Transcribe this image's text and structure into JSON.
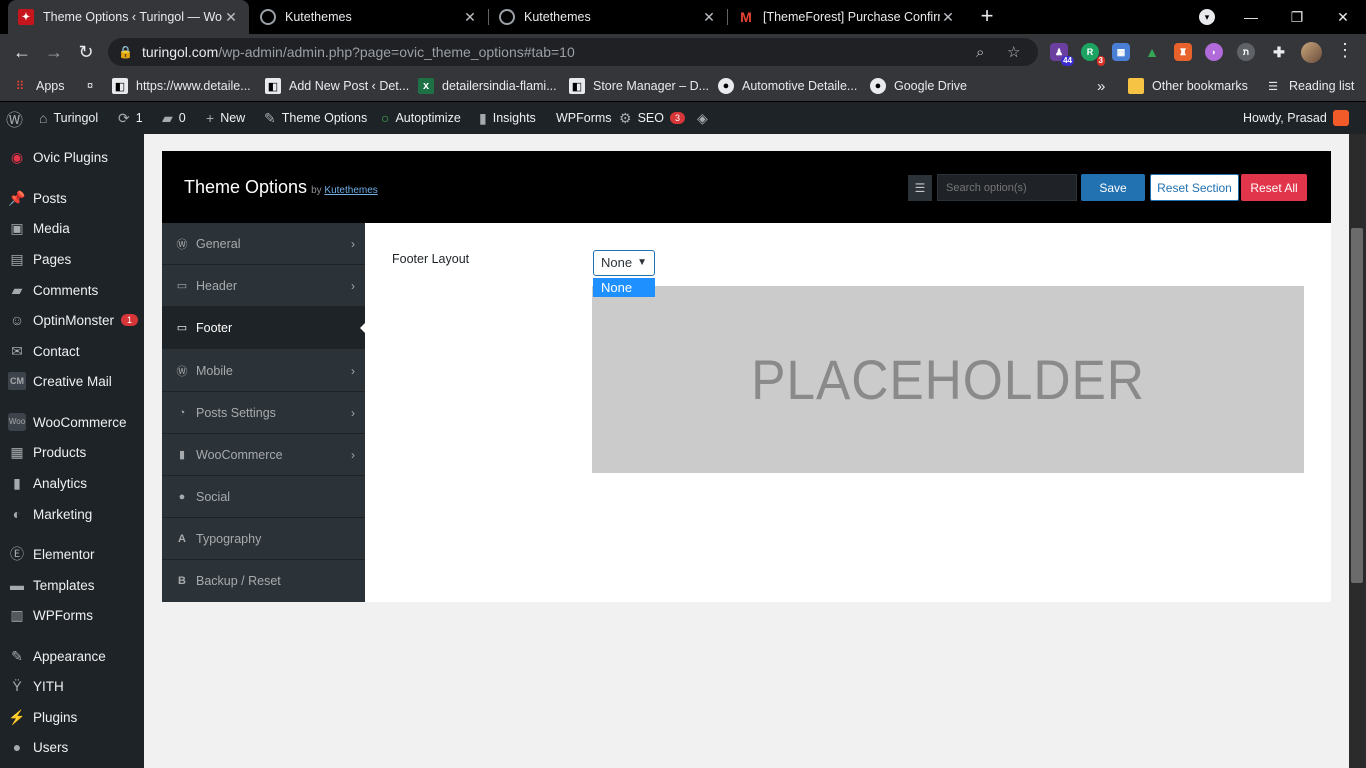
{
  "browser": {
    "tabs": [
      {
        "title": "Theme Options ‹ Turingol — Wo",
        "active": true
      },
      {
        "title": "Kutethemes",
        "active": false
      },
      {
        "title": "Kutethemes",
        "active": false
      },
      {
        "title": "[ThemeForest] Purchase Confirm",
        "active": false
      }
    ],
    "new_tab": "+",
    "url_host": "turingol.com",
    "url_path": "/wp-admin/admin.php?page=ovic_theme_options#tab=10",
    "extensions": [
      {
        "name": "ext-badge-44",
        "badge": "44"
      },
      {
        "name": "ext-badge-3",
        "badge": "3"
      }
    ],
    "bookmarks": [
      {
        "label": "Apps"
      },
      {
        "label": ""
      },
      {
        "label": "https://www.detaile..."
      },
      {
        "label": "Add New Post ‹ Det..."
      },
      {
        "label": "detailersindia-flami..."
      },
      {
        "label": "Store Manager – D..."
      },
      {
        "label": "Automotive Detaile..."
      },
      {
        "label": "Google Drive"
      }
    ],
    "bookmarks_overflow": "»",
    "other_bookmarks": "Other bookmarks",
    "reading_list": "Reading list"
  },
  "adminbar": {
    "site": "Turingol",
    "updates": "1",
    "comments": "0",
    "new": "New",
    "theme_options": "Theme Options",
    "autoptimize": "Autoptimize",
    "insights": "Insights",
    "wpforms": "WPForms",
    "seo": "SEO",
    "seo_badge": "3",
    "howdy": "Howdy, Prasad"
  },
  "sidebar": {
    "items": [
      {
        "label": "Ovic Plugins",
        "icon": "ovic-icon"
      },
      {
        "label": "Posts",
        "icon": "pin-icon"
      },
      {
        "label": "Media",
        "icon": "media-icon"
      },
      {
        "label": "Pages",
        "icon": "pages-icon"
      },
      {
        "label": "Comments",
        "icon": "comment-icon"
      },
      {
        "label": "OptinMonster",
        "icon": "optinmonster-icon",
        "badge": "1"
      },
      {
        "label": "Contact",
        "icon": "mail-icon"
      },
      {
        "label": "Creative Mail",
        "icon": "cm-icon"
      },
      {
        "label": "WooCommerce",
        "icon": "woo-icon"
      },
      {
        "label": "Products",
        "icon": "products-icon"
      },
      {
        "label": "Analytics",
        "icon": "analytics-icon"
      },
      {
        "label": "Marketing",
        "icon": "megaphone-icon"
      },
      {
        "label": "Elementor",
        "icon": "elementor-icon"
      },
      {
        "label": "Templates",
        "icon": "folder-icon"
      },
      {
        "label": "WPForms",
        "icon": "wpforms-icon"
      },
      {
        "label": "Appearance",
        "icon": "brush-icon"
      },
      {
        "label": "YITH",
        "icon": "yith-icon"
      },
      {
        "label": "Plugins",
        "icon": "plugin-icon"
      },
      {
        "label": "Users",
        "icon": "users-icon"
      }
    ]
  },
  "panel": {
    "title": "Theme Options",
    "by": "by",
    "author": "Kutethemes",
    "search_placeholder": "Search option(s)",
    "save": "Save",
    "reset_section": "Reset Section",
    "reset_all": "Reset All",
    "nav": [
      {
        "label": "General",
        "icon": "wordpress-icon",
        "arrow": true
      },
      {
        "label": "Header",
        "icon": "folder-icon",
        "arrow": true
      },
      {
        "label": "Footer",
        "icon": "folder-open-icon",
        "arrow": false,
        "active": true
      },
      {
        "label": "Mobile",
        "icon": "wordpress-icon",
        "arrow": true
      },
      {
        "label": "Posts Settings",
        "icon": "rss-icon",
        "arrow": true
      },
      {
        "label": "WooCommerce",
        "icon": "bag-icon",
        "arrow": true
      },
      {
        "label": "Social",
        "icon": "users-icon",
        "arrow": false
      },
      {
        "label": "Typography",
        "icon": "font-icon",
        "arrow": false
      },
      {
        "label": "Backup / Reset",
        "icon": "bold-icon",
        "arrow": false
      }
    ],
    "field_label": "Footer Layout",
    "select_value": "None",
    "dropdown_option": "None",
    "placeholder_text": "PLACEHOLDER"
  },
  "colors": {
    "wp_admin_bg": "#1d2327",
    "accent_blue": "#2271b1",
    "reset_red": "#e0354b",
    "dropdown_highlight": "#1e90ff"
  }
}
